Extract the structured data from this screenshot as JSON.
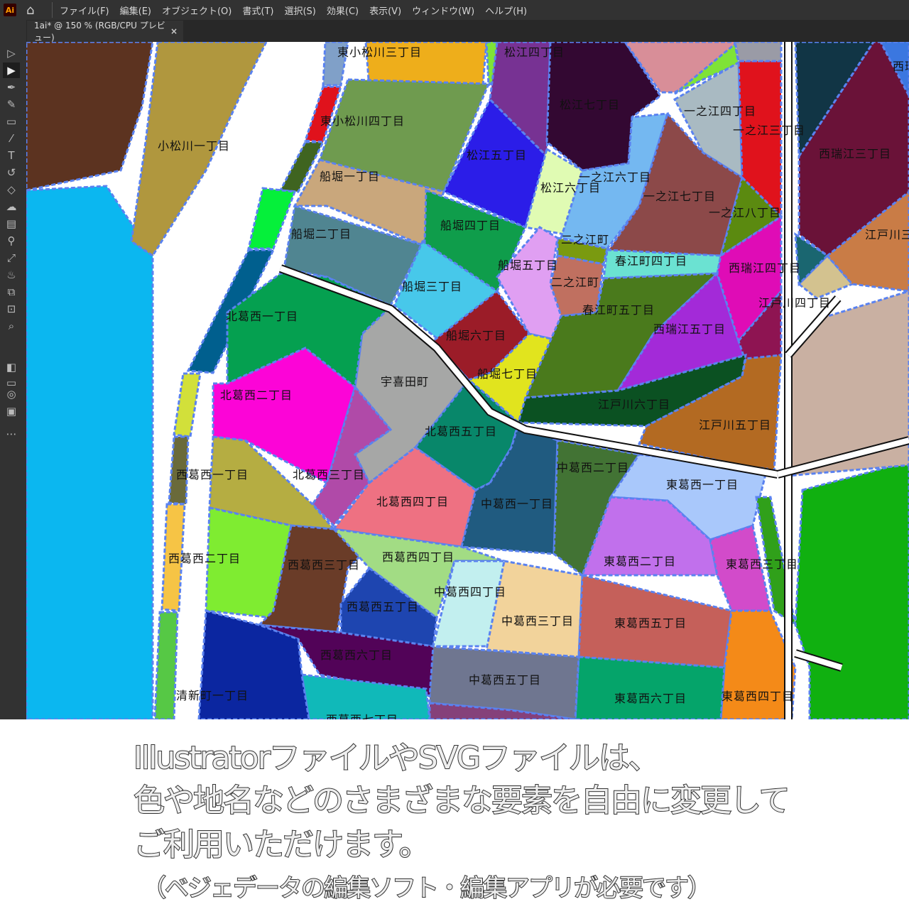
{
  "app": {
    "logo": "Ai",
    "menus": [
      "ファイル(F)",
      "編集(E)",
      "オブジェクト(O)",
      "書式(T)",
      "選択(S)",
      "効果(C)",
      "表示(V)",
      "ウィンドウ(W)",
      "ヘルプ(H)"
    ]
  },
  "document_tab": {
    "title": "1ai* @ 150 % (RGB/CPU プレビュー)",
    "close": "×"
  },
  "tools": [
    "selection-tool",
    "direct-selection-tool",
    "pen-tool",
    "curvature-tool",
    "rectangle-tool",
    "paintbrush-tool",
    "type-tool",
    "rotate-tool",
    "eraser-tool",
    "puppet-warp-tool",
    "gradient-tool",
    "width-tool",
    "eyedropper-tool",
    "symbol-sprayer-tool",
    "shape-builder-tool",
    "artboard-tool",
    "zoom-tool",
    "fill-stroke-swatch",
    "color-modes",
    "draw-mode",
    "screen-mode",
    "edit-toolbar"
  ],
  "map": {
    "labels": [
      "東小松川三丁目",
      "松江四丁目",
      "東小松川四丁目",
      "松江七丁目",
      "一之江四丁目",
      "一之江三丁目",
      "西瑞江三丁目",
      "小松川一丁目",
      "松江五丁目",
      "船堀一丁目",
      "一之江六丁目",
      "松江六丁目",
      "一之江七丁目",
      "一之江八丁目",
      "船堀二丁目",
      "船堀四丁目",
      "江戸川三丁目",
      "二之江町",
      "春江町四丁目",
      "船堀五丁目",
      "西瑞江四丁目",
      "二之江町",
      "船堀三丁目",
      "江戸川四丁目",
      "春江町五丁目",
      "北葛西一丁目",
      "西瑞江五丁目",
      "船堀六丁目",
      "船堀七丁目",
      "宇喜田町",
      "北葛西二丁目",
      "江戸川六丁目",
      "江戸川五丁目",
      "北葛西五丁目",
      "中葛西二丁目",
      "西葛西一丁目",
      "北葛西三丁目",
      "東葛西一丁目",
      "北葛西四丁目",
      "中葛西一丁目",
      "西葛西二丁目",
      "西葛西四丁目",
      "東葛西二丁目",
      "東葛西三丁目",
      "西葛西三丁目",
      "中葛西四丁目",
      "西葛西五丁目",
      "中葛西三丁目",
      "東葛西五丁目",
      "西葛西六丁目",
      "中葛西五丁目",
      "清新町一丁目",
      "東葛西六丁目",
      "東葛西四丁目",
      "西葛西七丁目",
      "西瑞"
    ],
    "anchor_color": "#5a82f0"
  },
  "caption": {
    "line1": "IllustratorファイルやSVGファイルは、",
    "line2": "色や地名などのさまざまな要素を自由に変更して",
    "line3": "ご利用いただけます。",
    "note": "（ベジェデータの編集ソフト・編集アプリが必要です）"
  }
}
